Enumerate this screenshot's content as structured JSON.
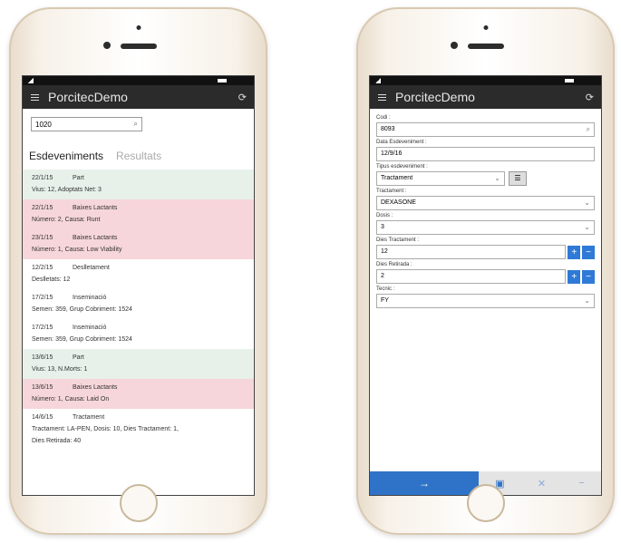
{
  "left": {
    "app_title": "PorcitecDemo",
    "search_value": "1020",
    "tabs": [
      "Esdeveniments",
      "Resultats"
    ],
    "events": [
      {
        "date": "22/1/15",
        "type": "Part",
        "detail": "Vius: 12, Adoptats Net: 3",
        "color": "green"
      },
      {
        "date": "22/1/15",
        "type": "Baixes Lactants",
        "detail": "Número: 2, Causa: Runt",
        "color": "red"
      },
      {
        "date": "23/1/15",
        "type": "Baixes Lactants",
        "detail": "Número: 1, Causa: Low Viability",
        "color": "red"
      },
      {
        "date": "12/2/15",
        "type": "Deslletament",
        "detail": "Deslletats: 12",
        "color": "white"
      },
      {
        "date": "17/2/15",
        "type": "Inseminació",
        "detail": "Semen: 359, Grup Cobriment: 1524",
        "color": "white"
      },
      {
        "date": "17/2/15",
        "type": "Inseminació",
        "detail": "Semen: 359, Grup Cobriment: 1524",
        "color": "white"
      },
      {
        "date": "13/6/15",
        "type": "Part",
        "detail": "Vius: 13, N.Morts: 1",
        "color": "green"
      },
      {
        "date": "13/6/15",
        "type": "Baixes Lactants",
        "detail": "Número: 1, Causa: Laid On",
        "color": "red"
      },
      {
        "date": "14/6/15",
        "type": "Tractament",
        "detail": "Tractament: LA-PEN, Dosis: 10, Dies Tractament: 1,",
        "detail2": "Dies Retirada: 40",
        "color": "white"
      }
    ]
  },
  "right": {
    "app_title": "PorcitecDemo",
    "fields": {
      "codi_label": "Codi :",
      "codi_value": "8093",
      "data_label": "Data Esdeveniment :",
      "data_value": "12/9/16",
      "tipus_label": "Tipus esdeveniment :",
      "tipus_value": "Tractament",
      "tractament_label": "Tractament :",
      "tractament_value": "DEXASONE",
      "dosis_label": "Dosis :",
      "dosis_value": "3",
      "dies_tractament_label": "Dies Tractament :",
      "dies_tractament_value": "12",
      "dies_retirada_label": "Dies Retirada :",
      "dies_retirada_value": "2",
      "tecnic_label": "Tecnic :",
      "tecnic_value": "FY"
    }
  }
}
